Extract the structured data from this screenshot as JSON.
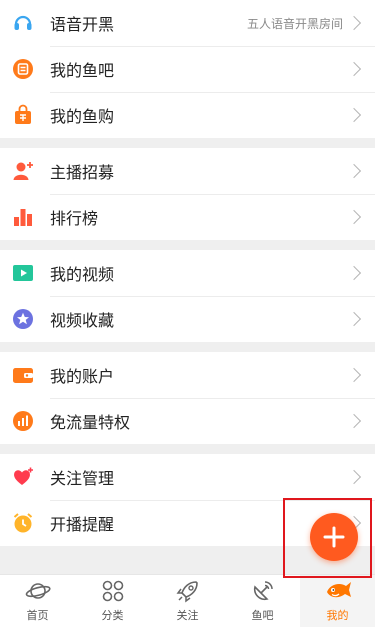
{
  "groups": [
    {
      "items": [
        {
          "label": "语音开黑",
          "extra": "五人语音开黑房间",
          "icon": "headset-icon"
        },
        {
          "label": "我的鱼吧",
          "icon": "fish-bar-icon"
        },
        {
          "label": "我的鱼购",
          "icon": "shopping-bag-icon"
        }
      ]
    },
    {
      "items": [
        {
          "label": "主播招募",
          "icon": "anchor-recruit-icon"
        },
        {
          "label": "排行榜",
          "icon": "ranking-icon"
        }
      ]
    },
    {
      "items": [
        {
          "label": "我的视频",
          "icon": "video-icon"
        },
        {
          "label": "视频收藏",
          "icon": "star-icon"
        }
      ]
    },
    {
      "items": [
        {
          "label": "我的账户",
          "icon": "wallet-icon"
        },
        {
          "label": "免流量特权",
          "icon": "data-plan-icon"
        }
      ]
    },
    {
      "items": [
        {
          "label": "关注管理",
          "icon": "heart-icon"
        },
        {
          "label": "开播提醒",
          "icon": "alarm-clock-icon"
        }
      ]
    }
  ],
  "tabs": [
    {
      "label": "首页",
      "icon": "planet-icon",
      "active": false
    },
    {
      "label": "分类",
      "icon": "grid-icon",
      "active": false
    },
    {
      "label": "关注",
      "icon": "rocket-icon",
      "active": false
    },
    {
      "label": "鱼吧",
      "icon": "satellite-dish-icon",
      "active": false
    },
    {
      "label": "我的",
      "icon": "fish-icon",
      "active": true
    }
  ],
  "fab": {
    "icon": "plus-icon"
  },
  "colors": {
    "accent": "#ff7700",
    "fab": "#ff5a1f",
    "highlight_box": "#e0171d"
  }
}
